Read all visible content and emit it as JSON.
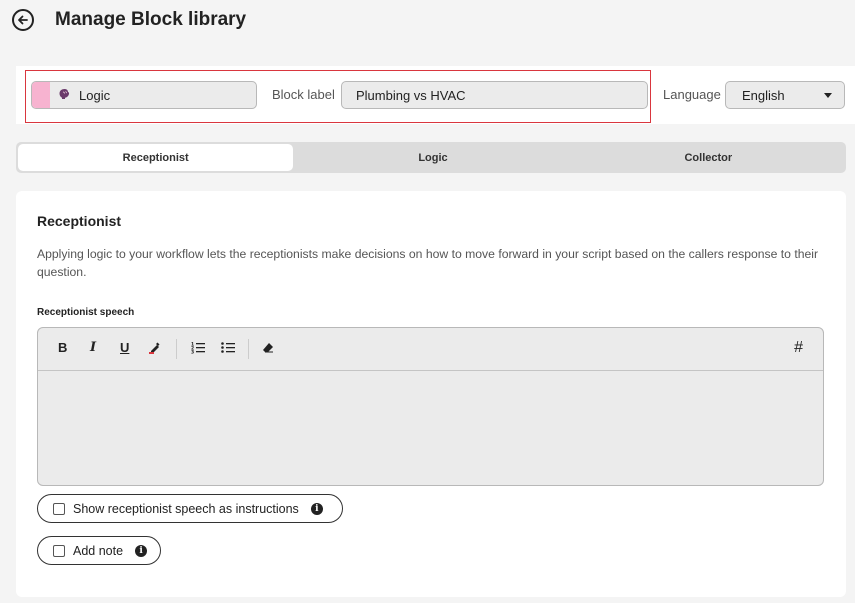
{
  "page": {
    "title": "Manage Block library"
  },
  "top_bar": {
    "block_type": "Logic",
    "block_label_text": "Block label",
    "block_label_value": "Plumbing vs HVAC",
    "language_text": "Language",
    "language_value": "English"
  },
  "tabs": [
    {
      "label": "Receptionist"
    },
    {
      "label": "Logic"
    },
    {
      "label": "Collector"
    }
  ],
  "content": {
    "section_title": "Receptionist",
    "description": "Applying logic to your workflow lets the receptionists make decisions on how to move forward in your script based on the callers response to their question.",
    "speech_label": "Receptionist speech",
    "toolbar": {
      "bold": "B",
      "italic": "I",
      "underline": "U",
      "hash": "#"
    },
    "show_instructions_label": "Show receptionist speech as instructions",
    "add_note_label": "Add note"
  },
  "colors": {
    "block_swatch": "#f7b3d0",
    "highlight_frame": "#d9363e"
  }
}
